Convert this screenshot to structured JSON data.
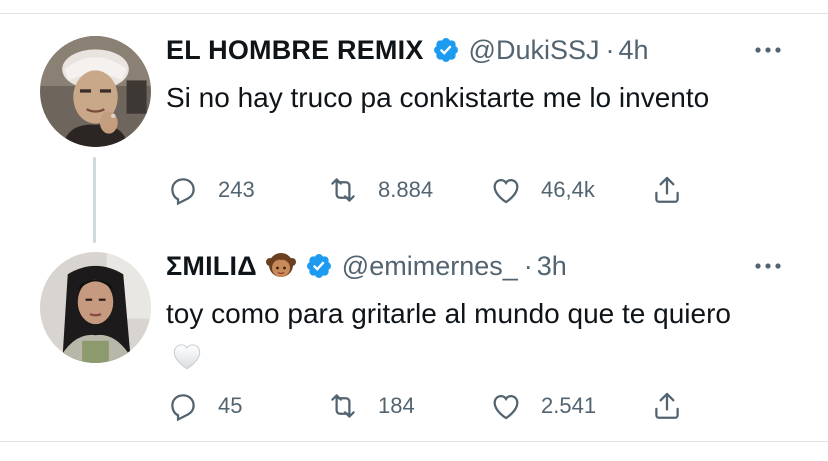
{
  "tweets": [
    {
      "name": "EL HOMBRE REMIX",
      "handle": "@DukiSSJ",
      "separator": "·",
      "time": "4h",
      "text": "Si no hay truco pa conkistarte me lo invento",
      "replies": "243",
      "retweets": "8.884",
      "likes": "46,4k",
      "verified_icon": "verified-badge-icon",
      "avatar": "profile-photo"
    },
    {
      "name": "ΣMILIΔ",
      "name_emoji": "girl-emoji",
      "handle": "@emimernes_",
      "separator": "·",
      "time": "3h",
      "text": "toy como para gritarle al mundo que te quiero",
      "text_emoji": "white-heart-emoji",
      "replies": "45",
      "retweets": "184",
      "likes": "2.541",
      "verified_icon": "verified-badge-icon",
      "avatar": "profile-photo"
    }
  ],
  "colors": {
    "text": "#0f1419",
    "secondary": "#536471",
    "verified": "#1d9bf0",
    "divider": "#dfe3e6",
    "thread_line": "#cfd9de"
  }
}
